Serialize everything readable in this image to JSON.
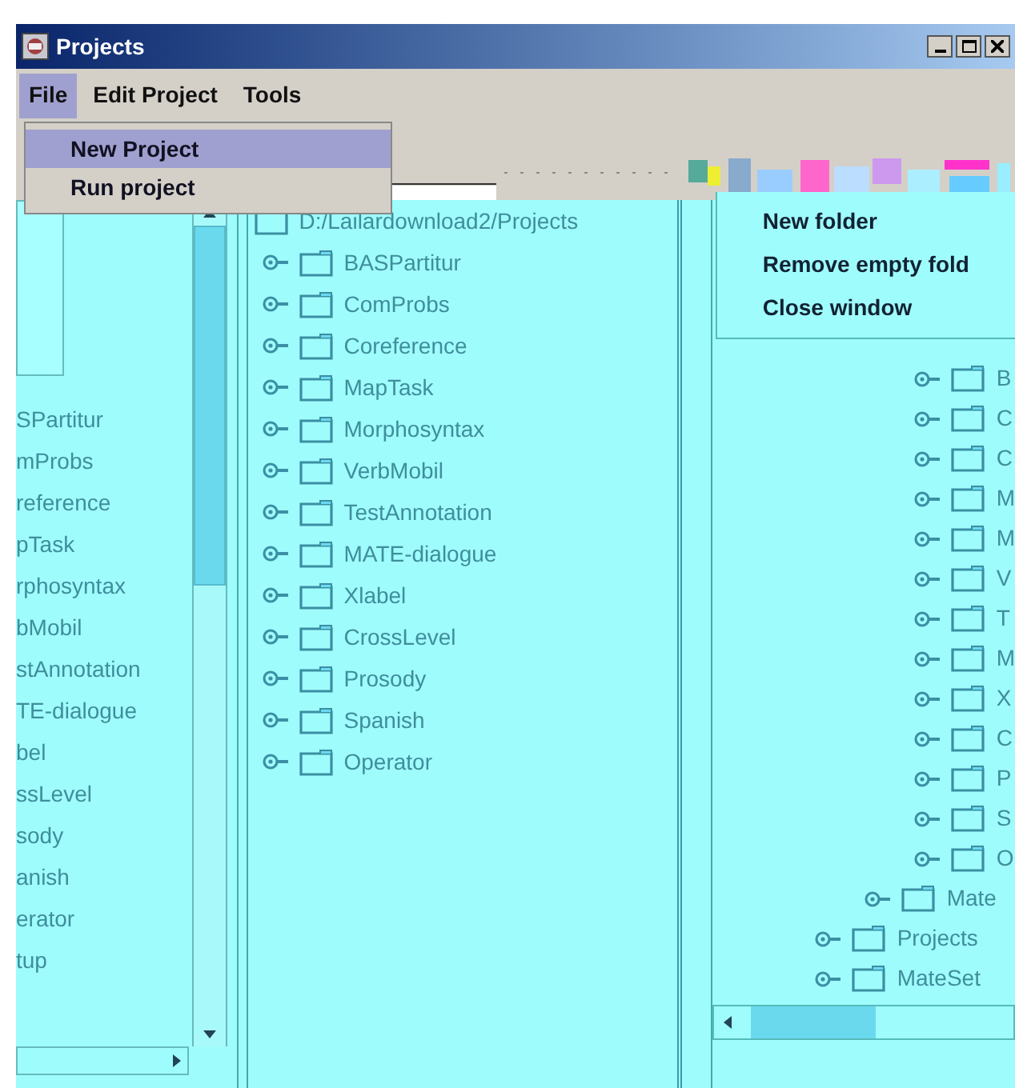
{
  "window": {
    "title": "Projects"
  },
  "menu_bar": [
    {
      "label": "File",
      "selected": true
    },
    {
      "label": "Edit Project",
      "selected": false
    },
    {
      "label": "Tools",
      "selected": false
    }
  ],
  "file_menu": [
    {
      "label": "New Project",
      "selected": true
    },
    {
      "label": "Run project",
      "selected": false
    }
  ],
  "left_list": [
    "SPartitur",
    "mProbs",
    "reference",
    "pTask",
    "rphosyntax",
    "bMobil",
    "stAnnotation",
    "TE-dialogue",
    "bel",
    "ssLevel",
    "sody",
    "anish",
    "erator",
    "tup"
  ],
  "middle_tree": {
    "root": "D:/Lailardownload2/Projects",
    "children": [
      {
        "label": "BASPartitur"
      },
      {
        "label": "ComProbs"
      },
      {
        "label": "Coreference"
      },
      {
        "label": "MapTask"
      },
      {
        "label": "Morphosyntax"
      },
      {
        "label": "VerbMobil"
      },
      {
        "label": "TestAnnotation"
      },
      {
        "label": "MATE-dialogue"
      },
      {
        "label": "Xlabel"
      },
      {
        "label": "CrossLevel"
      },
      {
        "label": "Prosody"
      },
      {
        "label": "Spanish"
      },
      {
        "label": "Operator"
      }
    ]
  },
  "context_menu": [
    "New folder",
    "Remove empty fold",
    "Close window"
  ],
  "right_tree": [
    {
      "children": [
        {
          "children": [
            {
              "label": "B"
            },
            {
              "label": "C"
            },
            {
              "label": "C"
            },
            {
              "label": "M"
            },
            {
              "label": "M"
            },
            {
              "label": "V"
            },
            {
              "label": "T"
            },
            {
              "label": "M"
            },
            {
              "label": "X"
            },
            {
              "label": "C"
            },
            {
              "label": "P"
            },
            {
              "label": "S"
            },
            {
              "label": "O"
            }
          ]
        },
        {
          "label": "Mate"
        }
      ]
    },
    {
      "label": "Projects"
    },
    {
      "label": "MateSet"
    }
  ]
}
